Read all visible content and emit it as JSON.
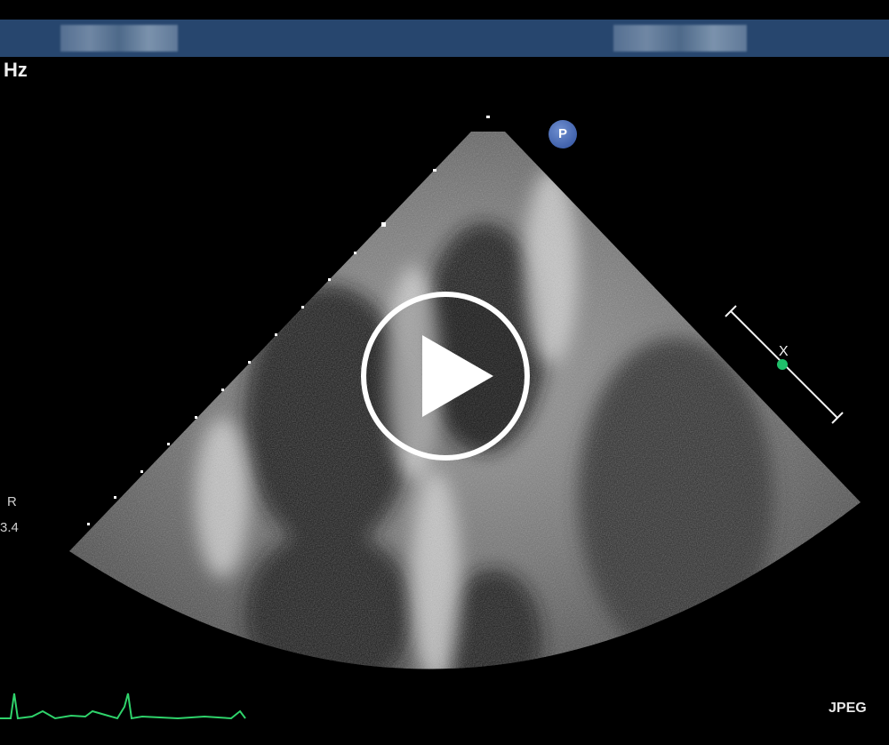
{
  "header": {
    "frequency_label": "Hz",
    "left_blurred_text": "",
    "right_blurred_text": ""
  },
  "overlay": {
    "probe_badge": "P",
    "orientation_label": "R",
    "orientation_value": "3.4",
    "format_label": "JPEG",
    "focus_marker_label": "X"
  },
  "player": {
    "play_icon": "play-icon"
  },
  "colors": {
    "header_bar": "#27466e",
    "ecg_trace": "#2fd36b",
    "focus_dot": "#1fbf6a",
    "probe_badge": "#3f62b3"
  }
}
